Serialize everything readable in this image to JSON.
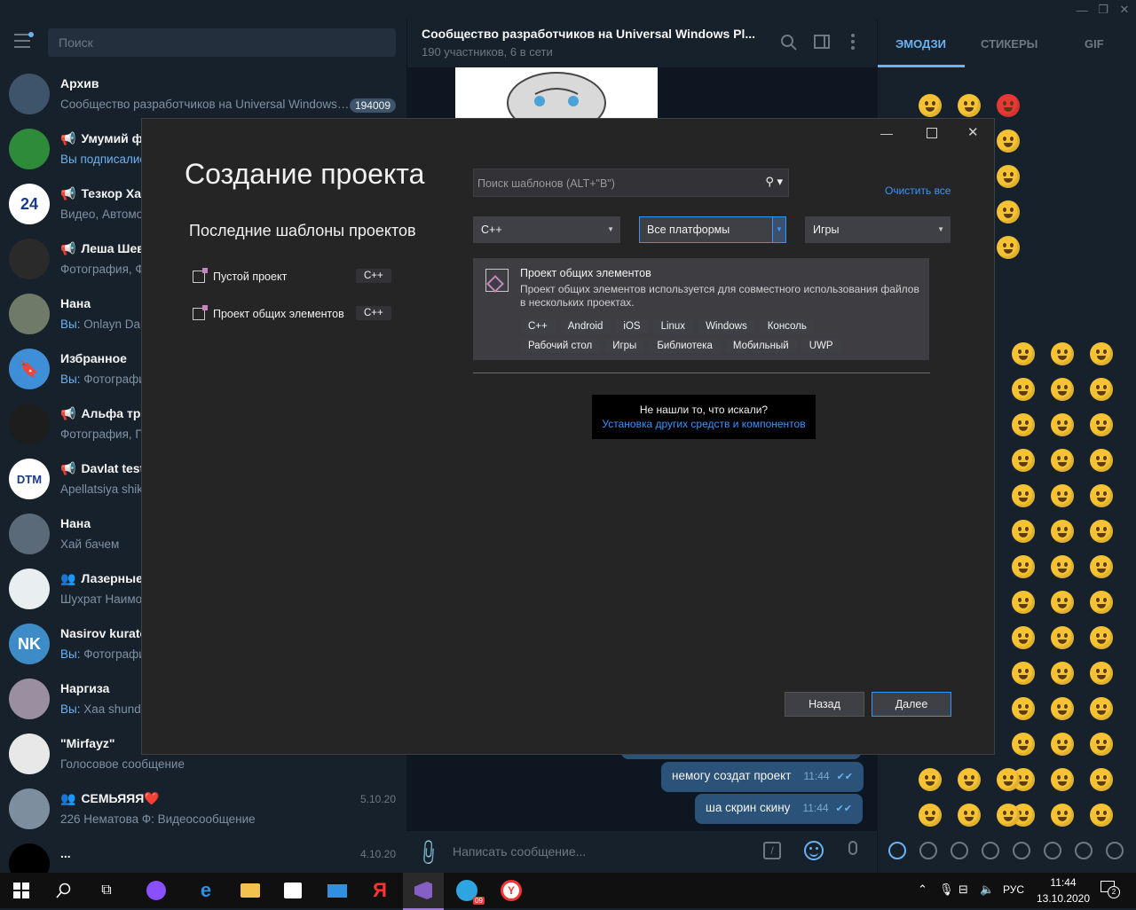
{
  "telegram": {
    "search_placeholder": "Поиск",
    "chats": [
      {
        "name": "Архив",
        "preview_who": "",
        "preview": "Сообщество разработчиков на Universal Windows…",
        "badge": "194009",
        "date": "",
        "avatar_color": "#3e546a",
        "avatar_text": ""
      },
      {
        "name": "Умумий ф",
        "channel": true,
        "preview_who": "Вы подписалис",
        "preview": "",
        "badge": "",
        "date": "",
        "avatar_color": "#2e8b3a",
        "avatar_text": ""
      },
      {
        "name": "Тезкор Хаб",
        "channel": true,
        "preview_who": "",
        "preview": "Видео, Автомо",
        "badge": "",
        "date": "",
        "avatar_color": "#ffffff",
        "avatar_text": "24"
      },
      {
        "name": "Леша Шев",
        "channel": true,
        "preview_who": "",
        "preview": "Фотография, Ф",
        "badge": "",
        "date": "",
        "avatar_color": "#2a2a2a",
        "avatar_text": ""
      },
      {
        "name": "Нана",
        "preview_who": "Вы:",
        "preview": " Onlayn Dar",
        "badge": "",
        "date": "",
        "avatar_color": "#6f7b68",
        "avatar_text": ""
      },
      {
        "name": "Избранное",
        "preview_who": "Вы:",
        "preview": " Фотографи",
        "badge": "",
        "date": "",
        "avatar_color": "#3f8ed8",
        "avatar_text": "🔖"
      },
      {
        "name": "Альфа тре",
        "channel": true,
        "preview_who": "",
        "preview": "Фотография, П",
        "badge": "",
        "date": "",
        "avatar_color": "#1d1d1d",
        "avatar_text": ""
      },
      {
        "name": "Davlat test",
        "channel": true,
        "preview_who": "",
        "preview": "Apellatsiya shik",
        "badge": "",
        "date": "",
        "avatar_color": "#ffffff",
        "avatar_text": "DTM"
      },
      {
        "name": "Нана",
        "preview_who": "",
        "preview": "Хай бачем",
        "badge": "",
        "date": "",
        "avatar_color": "#5a6a78",
        "avatar_text": ""
      },
      {
        "name": "Лазерные",
        "group": true,
        "preview_who": "",
        "preview": "Шухрат Наимо",
        "badge": "",
        "date": "",
        "avatar_color": "#e9eef0",
        "avatar_text": ""
      },
      {
        "name": "Nasirov kurato",
        "preview_who": "Вы:",
        "preview": " Фотографи",
        "badge": "",
        "date": "",
        "avatar_color": "#3e8cc7",
        "avatar_text": "NK"
      },
      {
        "name": "Наргиза",
        "preview_who": "Вы:",
        "preview": " Xaa shunda",
        "badge": "",
        "date": "",
        "avatar_color": "#9a8ea0",
        "avatar_text": ""
      },
      {
        "name": "\"Mirfayz\"",
        "preview_who": "",
        "preview": "Голосовое сообщение",
        "badge": "",
        "date": "",
        "avatar_color": "#e8e8e8",
        "avatar_text": ""
      },
      {
        "name": "СЕМЬЯЯЯ❤️",
        "group": true,
        "preview_who": "",
        "preview": "226 Нематова Ф: Видеосообщение",
        "badge": "",
        "date": "5.10.20",
        "avatar_color": "#7d8f9e",
        "avatar_text": ""
      },
      {
        "name": "...",
        "preview_who": "",
        "preview": "",
        "badge": "",
        "date": "4.10.20",
        "avatar_color": "#000000",
        "avatar_text": ""
      }
    ],
    "header_title": "Сообщество разработчиков на Universal Windows Pl...",
    "header_subtitle": "190 участников, 6 в сети",
    "messages": [
      {
        "text": "немогу создат проект",
        "time": "11:44"
      },
      {
        "text": "ша скрин скину",
        "time": "11:44"
      }
    ],
    "composer_placeholder": "Написать сообщение...",
    "emoji_tabs": [
      "ЭМОДЗИ",
      "СТИКЕРЫ",
      "GIF"
    ]
  },
  "vs_dialog": {
    "title": "Создание проекта",
    "recent_heading": "Последние шаблоны проектов",
    "recent": [
      {
        "label": "Пустой проект",
        "lang": "C++"
      },
      {
        "label": "Проект общих элементов",
        "lang": "C++"
      }
    ],
    "search_placeholder": "Поиск шаблонов (ALT+\"В\")",
    "clear_all": "Очистить все",
    "filter_language": "C++",
    "filter_platform": "Все платформы",
    "filter_type": "Игры",
    "template": {
      "title": "Проект общих элементов",
      "description": "Проект общих элементов используется для совместного использования файлов в нескольких проектах.",
      "tags": [
        "C++",
        "Android",
        "iOS",
        "Linux",
        "Windows",
        "Консоль",
        "Рабочий стол",
        "Игры",
        "Библиотека",
        "Мобильный",
        "UWP"
      ]
    },
    "not_found_text": "Не нашли то, что искали?",
    "not_found_link": "Установка других средств и компонентов",
    "back_label": "Назад",
    "next_label": "Далее"
  },
  "taskbar": {
    "time": "11:44",
    "date": "13.10.2020",
    "lang": "РУС",
    "notifications": "2",
    "telegram_badge": "09"
  }
}
